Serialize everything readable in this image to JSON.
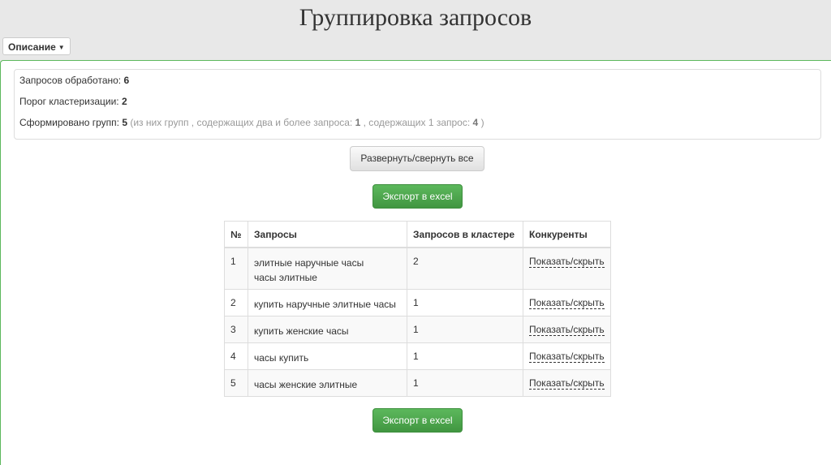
{
  "page": {
    "title": "Группировка запросов"
  },
  "description_button": {
    "label": "Описание"
  },
  "stats": {
    "processed_label": "Запросов обработано:",
    "processed_value": "6",
    "threshold_label": "Порог кластеризации:",
    "threshold_value": "2",
    "groups_label": "Сформировано групп:",
    "groups_value": "5",
    "groups_detail_prefix": "(из них групп , содержащих два и более запроса:",
    "groups_multi_value": "1",
    "groups_detail_middle": ", содержащих 1 запрос:",
    "groups_single_value": "4",
    "groups_detail_suffix": ")"
  },
  "toggle_all_button": {
    "label": "Развернуть/свернуть все"
  },
  "export_button": {
    "label": "Экспорт в excel"
  },
  "table": {
    "headers": [
      "№",
      "Запросы",
      "Запросов в кластере",
      "Конкуренты"
    ],
    "rows": [
      {
        "n": "1",
        "queries": [
          "элитные наручные часы",
          "часы элитные"
        ],
        "count": "2",
        "competitors": "Показать/скрыть"
      },
      {
        "n": "2",
        "queries": [
          "купить наручные элитные часы"
        ],
        "count": "1",
        "competitors": "Показать/скрыть"
      },
      {
        "n": "3",
        "queries": [
          "купить женские часы"
        ],
        "count": "1",
        "competitors": "Показать/скрыть"
      },
      {
        "n": "4",
        "queries": [
          "часы купить"
        ],
        "count": "1",
        "competitors": "Показать/скрыть"
      },
      {
        "n": "5",
        "queries": [
          "часы женские элитные"
        ],
        "count": "1",
        "competitors": "Показать/скрыть"
      }
    ]
  },
  "colors": {
    "success": "#5cb85c",
    "muted": "#999999"
  }
}
